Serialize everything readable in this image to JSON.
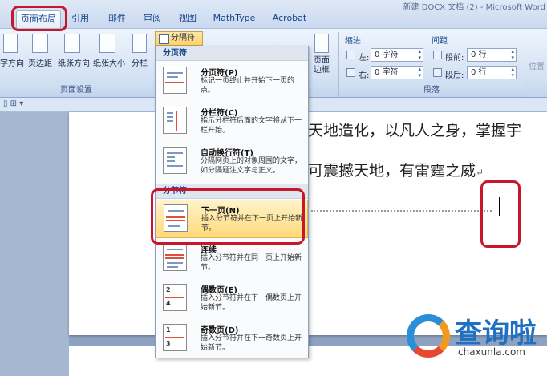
{
  "window": {
    "title": "新建 DOCX 文档 (2) - Microsoft Word"
  },
  "tabs": [
    {
      "label": "页面布局",
      "active": true
    },
    {
      "label": "引用"
    },
    {
      "label": "邮件"
    },
    {
      "label": "审阅"
    },
    {
      "label": "视图"
    },
    {
      "label": "MathType"
    },
    {
      "label": "Acrobat"
    }
  ],
  "ribbon": {
    "buttons": {
      "text_direction": "字方向",
      "margins": "页边距",
      "orientation": "纸张方向",
      "size": "纸张大小",
      "columns": "分栏",
      "page_border": "页面\n边框",
      "position": "位置"
    },
    "breaks_button": "分隔符",
    "group_page_setup": "页面设置",
    "indent": {
      "title": "缩进",
      "left_label": "左:",
      "left_value": "0 字符",
      "right_label": "右:",
      "right_value": "0 字符"
    },
    "spacing": {
      "title": "间距",
      "before_label": "段前:",
      "before_value": "0 行",
      "after_label": "段后:",
      "after_value": "0 行"
    },
    "group_paragraph": "段落"
  },
  "document": {
    "line1": "天地造化，以凡人之身，掌握宇",
    "line2": "可震撼天地，有雷霆之威",
    "return_mark": "↵"
  },
  "menu": {
    "section_page": "分页符",
    "section_section": "分节符",
    "items": [
      {
        "title": "分页符(P)",
        "desc": "标记一页终止并开始下一页的点。"
      },
      {
        "title": "分栏符(C)",
        "desc": "指示分栏符后面的文字将从下一栏开始。"
      },
      {
        "title": "自动换行符(T)",
        "desc": "分隔网页上的对象周围的文字，如分隔题注文字与正文。"
      },
      {
        "title": "下一页(N)",
        "desc": "插入分节符并在下一页上开始新节。"
      },
      {
        "title": "连续",
        "desc": "插入分节符并在同一页上开始新节。"
      },
      {
        "title": "偶数页(E)",
        "desc": "插入分节符并在下一偶数页上开始新节。"
      },
      {
        "title": "奇数页(D)",
        "desc": "插入分节符并在下一奇数页上开始新节。"
      }
    ]
  },
  "watermark": {
    "brand": "查询啦",
    "url": "chaxunla.com"
  },
  "colors": {
    "highlight": "#ffd97a",
    "annotation_red": "#c8172a",
    "ribbon_blue": "#15428b"
  }
}
